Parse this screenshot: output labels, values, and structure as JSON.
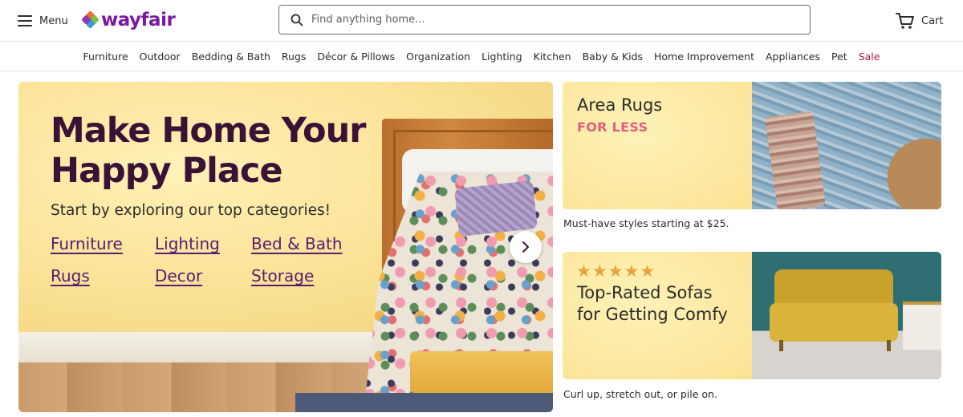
{
  "header": {
    "menu_label": "Menu",
    "logo_text": "wayfair",
    "search_placeholder": "Find anything home...",
    "cart_label": "Cart"
  },
  "nav": {
    "items": [
      "Furniture",
      "Outdoor",
      "Bedding & Bath",
      "Rugs",
      "Décor & Pillows",
      "Organization",
      "Lighting",
      "Kitchen",
      "Baby & Kids",
      "Home Improvement",
      "Appliances",
      "Pet",
      "Sale"
    ]
  },
  "hero": {
    "title": "Make Home Your\nHappy Place",
    "subtitle": "Start by exploring our top categories!",
    "links": [
      "Furniture",
      "Lighting",
      "Bed & Bath",
      "Rugs",
      "Decor",
      "Storage"
    ],
    "next_icon": "chevron-right-icon"
  },
  "promos": [
    {
      "title": "Area Rugs",
      "accent": "FOR LESS",
      "caption": "Must-have styles starting at $25."
    },
    {
      "rating_stars": 5,
      "stars_text": "★★★★★",
      "title": "Top-Rated Sofas\nfor Getting Comfy",
      "caption": "Curl up, stretch out, or pile on."
    }
  ],
  "colors": {
    "brand_purple": "#7b189f",
    "hero_title": "#3a1237",
    "hero_link": "#5b1a72",
    "sale_red": "#b0164e",
    "accent_pink": "#e0607b",
    "star_gold": "#e8a33a",
    "promo_yellow": "#fbe49a"
  }
}
